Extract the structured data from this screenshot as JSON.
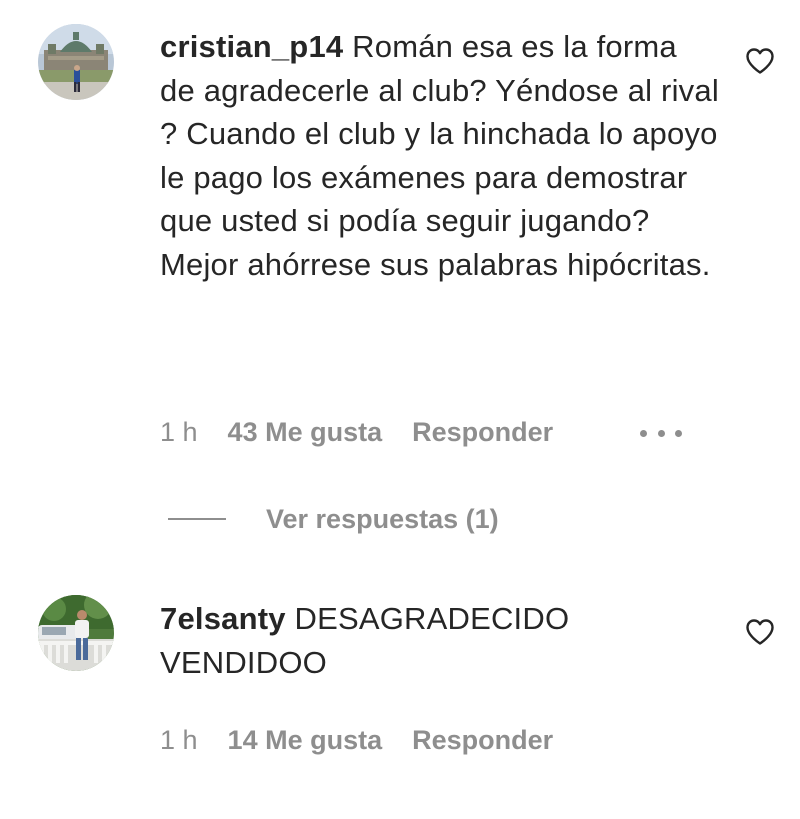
{
  "comments": [
    {
      "username": "cristian_p14",
      "text": "Román esa es la forma de agradecerle al club? Yéndose al rival ? Cuando el club y la hinchada lo apoyo le pago los exámenes para demostrar que usted si podía seguir jugando? Mejor ahórrese sus palabras hipócritas.",
      "time": "1 h",
      "likes": "43 Me gusta",
      "reply_label": "Responder",
      "more_icon": "more-options-icon",
      "like_icon": "heart-icon"
    },
    {
      "username": "7elsanty",
      "text": "DESAGRADECIDO VENDIDOO",
      "time": "1 h",
      "likes": "14 Me gusta",
      "reply_label": "Responder",
      "like_icon": "heart-icon"
    }
  ],
  "view_replies": {
    "label": "Ver respuestas (1)"
  },
  "colors": {
    "text": "#262626",
    "secondary": "#8e8e8e",
    "background": "#ffffff"
  }
}
